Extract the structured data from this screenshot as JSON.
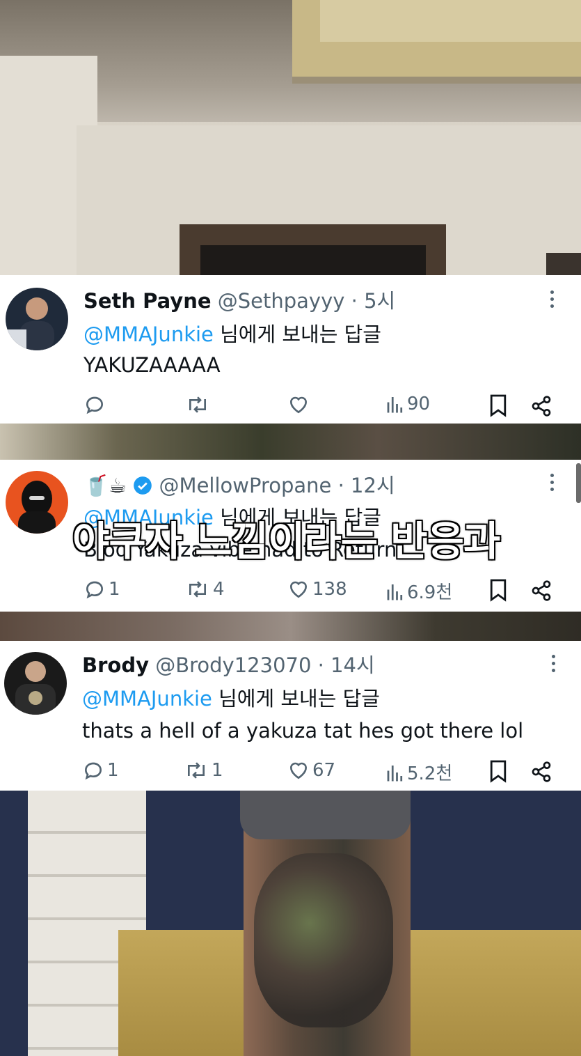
{
  "tweets": [
    {
      "display_name": "Seth Payne",
      "handle": "@Sethpayyy",
      "time": "· 5시",
      "reply_handle": "@MMAJunkie",
      "reply_suffix": " 님에게 보내는 답글",
      "text": "YAKUZAAAAA",
      "replies": "",
      "retweets": "",
      "likes": "",
      "views": "90"
    },
    {
      "display_name": "🥤☕",
      "verified": true,
      "handle": "@MellowPropane",
      "time": "· 12시",
      "reply_handle": "@MMAJunkie",
      "reply_suffix": " 님에게 보내는 답글",
      "text": "Blod Yakuza vibe had to Return",
      "replies": "1",
      "retweets": "4",
      "likes": "138",
      "views": "6.9천"
    },
    {
      "display_name": "Brody",
      "handle": "@Brody123070",
      "time": "· 14시",
      "reply_handle": "@MMAJunkie",
      "reply_suffix": " 님에게 보내는 답글",
      "text": "thats a hell of a yakuza tat hes got there lol",
      "replies": "1",
      "retweets": "1",
      "likes": "67",
      "views": "5.2천"
    }
  ],
  "caption": "야쿠자 느낌이라는 반응과",
  "colors": {
    "link": "#1d9bf0",
    "verified": "#1d9bf0",
    "muted": "#536471",
    "text": "#0f1419"
  }
}
